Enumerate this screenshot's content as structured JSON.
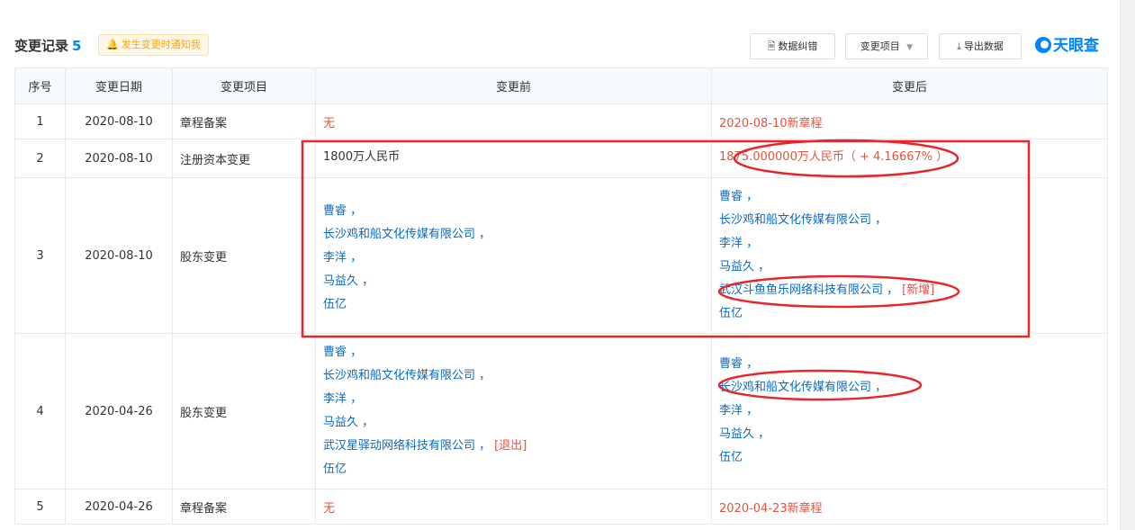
{
  "header": {
    "title": "变更记录",
    "count": "5",
    "notify_label": "发生变更时通知我",
    "correct_label": "数据纠错",
    "filter_label": "变更项目",
    "export_label": "导出数据",
    "logo_text": "天眼查"
  },
  "table": {
    "columns": [
      "序号",
      "变更日期",
      "变更项目",
      "变更前",
      "变更后"
    ],
    "rows": [
      {
        "no": "1",
        "date": "2020-08-10",
        "item": "章程备案",
        "before": "无",
        "after": "2020-08-10新章程"
      },
      {
        "no": "2",
        "date": "2020-08-10",
        "item": "注册资本变更",
        "before": "1800万人民币",
        "after": "1875.000000万人民币（ + 4.16667% ）"
      },
      {
        "no": "3",
        "date": "2020-08-10",
        "item": "股东变更",
        "before": [
          "曹睿 ，",
          "长沙鸡和船文化传媒有限公司 ，",
          "李洋 ，",
          "马益久 ，",
          "伍亿"
        ],
        "after": [
          "曹睿 ，",
          "长沙鸡和船文化传媒有限公司 ，",
          "李洋 ，",
          "马益久 ，",
          "武汉斗鱼鱼乐网络科技有限公司 ，",
          "伍亿"
        ],
        "after_tag": "[新增]"
      },
      {
        "no": "4",
        "date": "2020-04-26",
        "item": "股东变更",
        "before": [
          "曹睿 ，",
          "长沙鸡和船文化传媒有限公司 ，",
          "李洋 ，",
          "马益久 ，",
          "武汉星驿动网络科技有限公司 ，",
          "伍亿"
        ],
        "before_tag": "[退出]",
        "after": [
          "曹睿 ，",
          "长沙鸡和船文化传媒有限公司 ，",
          "李洋 ，",
          "马益久 ，",
          "伍亿"
        ]
      },
      {
        "no": "5",
        "date": "2020-04-26",
        "item": "章程备案",
        "before": "无",
        "after": "2020-04-23新章程"
      }
    ]
  },
  "colors": {
    "accent": "#0084ff",
    "annotation": "#e5262b",
    "red_text": "#e5533d",
    "link": "#0969c3"
  }
}
